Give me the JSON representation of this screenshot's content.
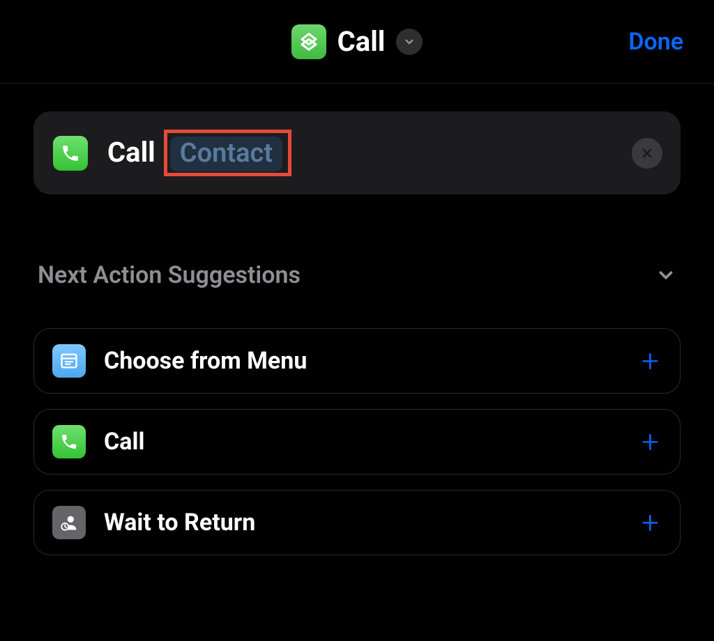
{
  "header": {
    "title": "Call",
    "done_label": "Done"
  },
  "action": {
    "verb": "Call",
    "param_token": "Contact"
  },
  "suggestions_header": "Next Action Suggestions",
  "suggestions": [
    {
      "label": "Choose from Menu",
      "icon": "menu"
    },
    {
      "label": "Call",
      "icon": "phone"
    },
    {
      "label": "Wait to Return",
      "icon": "wait"
    }
  ]
}
